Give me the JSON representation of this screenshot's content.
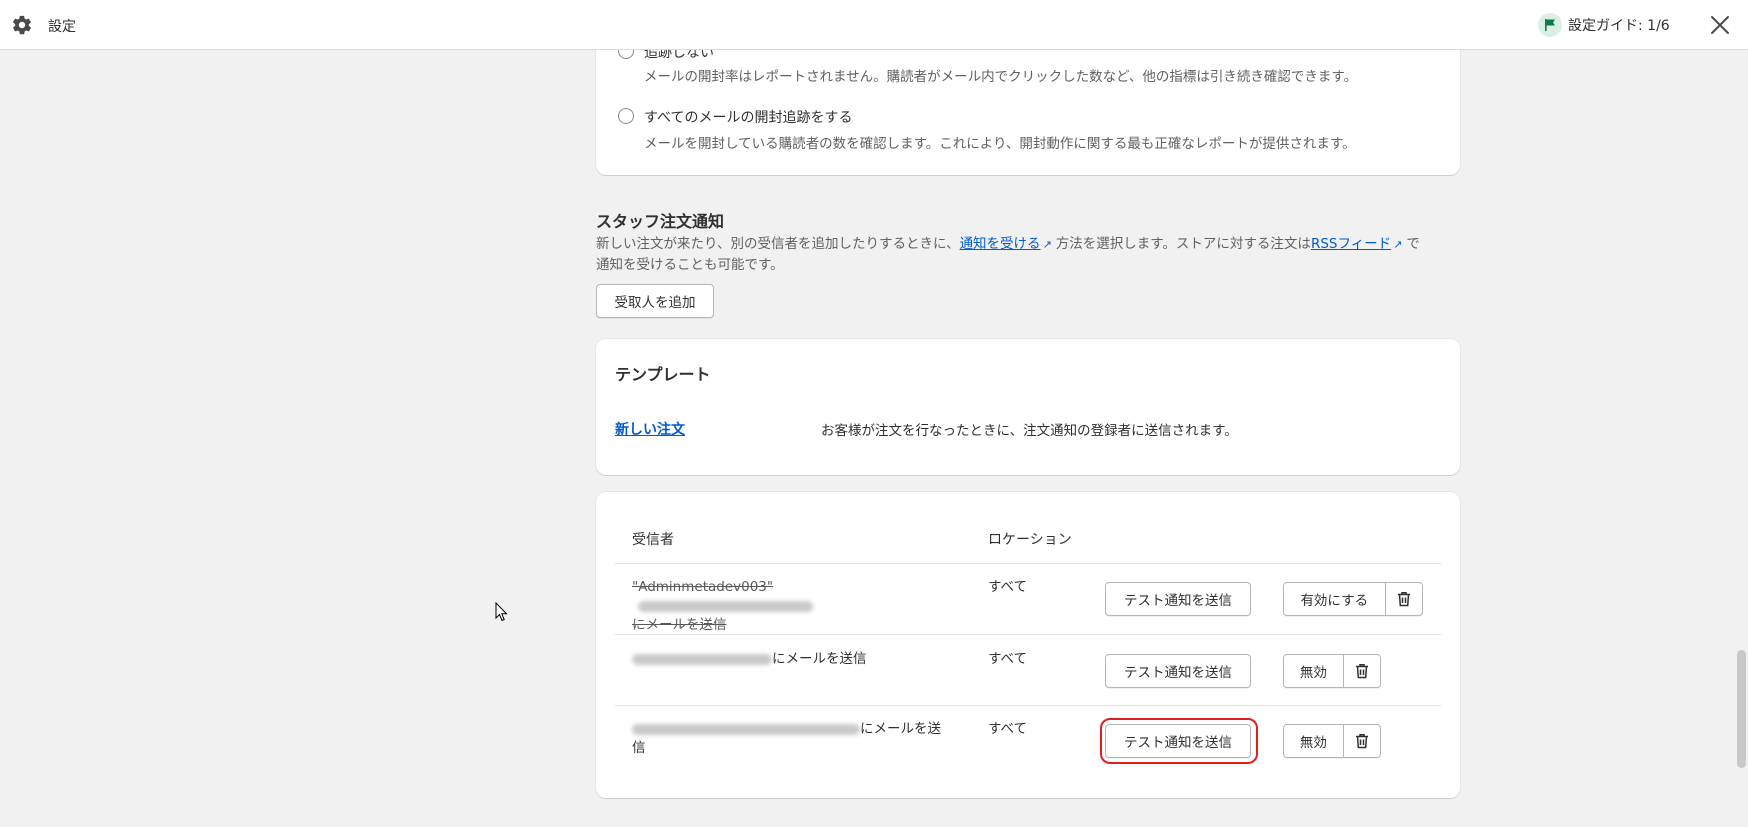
{
  "topbar": {
    "title": "設定",
    "guide_label": "設定ガイド: 1/6",
    "icons": [
      "gear-icon",
      "flag-icon",
      "close-icon"
    ]
  },
  "tracking": {
    "option1_label": "追跡しない",
    "option1_help": "メールの開封率はレポートされません。購読者がメール内でクリックした数など、他の指標は引き続き確認できます。",
    "option2_label": "すべてのメールの開封追跡をする",
    "option2_help": "メールを開封している購読者の数を確認します。これにより、開封動作に関する最も正確なレポートが提供されます。"
  },
  "staff": {
    "title": "スタッフ注文通知",
    "desc_part1": "新しい注文が来たり、別の受信者を追加したりするときに、",
    "link1": "通知を受ける",
    "desc_part2": "方法を選択します。ストアに対する注文は",
    "link2": "RSSフィード",
    "desc_part3": "で通知を受けることも可能です。",
    "add_button": "受取人を追加"
  },
  "templates": {
    "title": "テンプレート",
    "link": "新しい注文",
    "description": "お客様が注文を行なったときに、注文通知の登録者に送信されます。"
  },
  "recipients": {
    "col_recipient": "受信者",
    "col_location": "ロケーション",
    "rows": [
      {
        "name_prefix": "\"Adminmetadev003\"",
        "suffix": "にメールを送信",
        "location": "すべて",
        "test_label": "テスト通知を送信",
        "toggle_label": "有効にする",
        "disabled": true
      },
      {
        "suffix": "にメールを送信",
        "location": "すべて",
        "test_label": "テスト通知を送信",
        "toggle_label": "無効"
      },
      {
        "suffix": "にメールを送信",
        "location": "すべて",
        "test_label": "テスト通知を送信",
        "toggle_label": "無効"
      }
    ]
  },
  "colors": {
    "link": "#005bd3",
    "highlight": "#e02020",
    "background": "#f1f1f1"
  }
}
